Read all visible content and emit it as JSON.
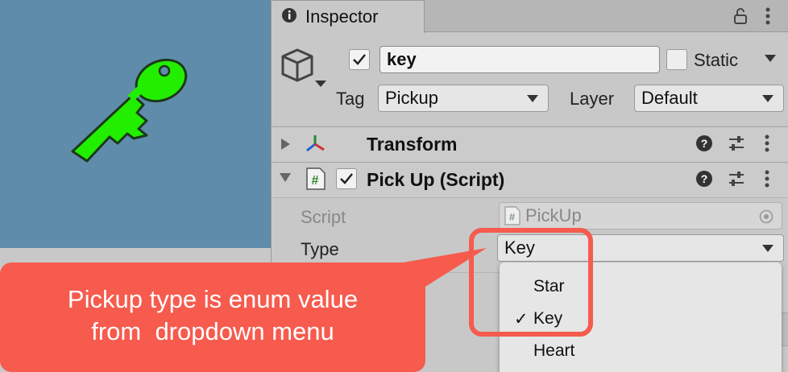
{
  "inspector": {
    "tab_label": "Inspector",
    "gameobject": {
      "active": true,
      "name": "key",
      "static_label": "Static",
      "static_checked": false,
      "tag_label": "Tag",
      "tag_value": "Pickup",
      "layer_label": "Layer",
      "layer_value": "Default"
    },
    "components": [
      {
        "title": "Transform",
        "expanded": false
      },
      {
        "title": "Pick Up (Script)",
        "expanded": true,
        "enabled": true
      }
    ],
    "pickup_script": {
      "script_label": "Script",
      "script_value": "PickUp",
      "type_label": "Type",
      "type_value": "Key"
    },
    "type_dropdown": {
      "options": [
        "Star",
        "Key",
        "Heart"
      ],
      "selected": "Key",
      "check_mark": "✓"
    }
  },
  "callout": {
    "line1": "Pickup type is enum value",
    "line2": "from  dropdown menu"
  },
  "colors": {
    "scene_bg": "#5f8caa",
    "key_fill": "#22ee00",
    "callout": "#f65b4e",
    "panel_bg": "#c8c8c8"
  },
  "icons": [
    "key-sprite",
    "lock-icon",
    "kebab-menu-icon",
    "cube-icon",
    "transform-axis-icon",
    "script-hash-icon",
    "help-icon",
    "sliders-icon",
    "object-picker-icon"
  ]
}
